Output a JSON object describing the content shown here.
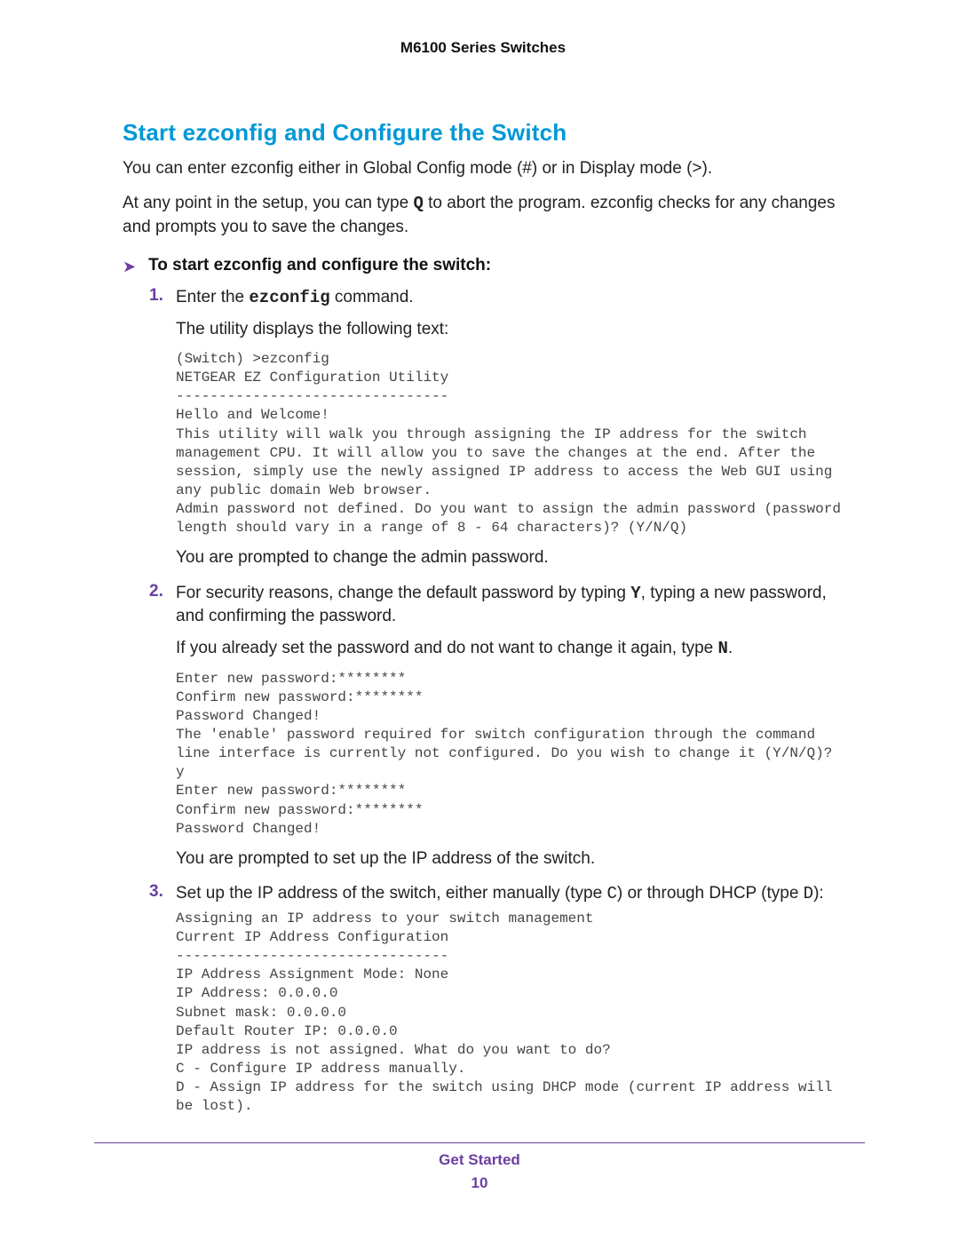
{
  "header": {
    "title": "M6100 Series Switches"
  },
  "section": {
    "title": "Start ezconfig and Configure the Switch",
    "intro1_a": "You can enter ezconfig either in Global Config mode (#) or in Display mode (>).",
    "intro2_a": "At any point in the setup, you can type ",
    "intro2_code": "Q",
    "intro2_b": " to abort the program. ezconfig checks for any changes and prompts you to save the changes."
  },
  "procedure": {
    "arrow": "➤",
    "title": "To start ezconfig and configure the switch:",
    "steps": [
      {
        "num": "1.",
        "text_a": "Enter the ",
        "code": "ezconfig",
        "text_b": " command.",
        "sub1": "The utility displays the following text:",
        "console": "(Switch) >ezconfig\nNETGEAR EZ Configuration Utility\n--------------------------------\nHello and Welcome!\nThis utility will walk you through assigning the IP address for the switch management CPU. It will allow you to save the changes at the end. After the session, simply use the newly assigned IP address to access the Web GUI using any public domain Web browser.\nAdmin password not defined. Do you want to assign the admin password (password length should vary in a range of 8 - 64 characters)? (Y/N/Q)",
        "sub2": "You are prompted to change the admin password."
      },
      {
        "num": "2.",
        "text_a": "For security reasons, change the default password by typing ",
        "code1": "Y",
        "text_b": ", typing a new password, and confirming the password.",
        "sub1_a": "If you already set the password and do not want to change it again, type ",
        "sub1_code": "N",
        "sub1_b": ".",
        "console": "Enter new password:********\nConfirm new password:********\nPassword Changed!\nThe 'enable' password required for switch configuration through the command line interface is currently not configured. Do you wish to change it (Y/N/Q)?  y\nEnter new password:********\nConfirm new password:********\nPassword Changed!",
        "sub2": "You are prompted to set up the IP address of the switch."
      },
      {
        "num": "3.",
        "text_a": "Set up the IP address of the switch, either manually (type ",
        "code1": "C",
        "text_b": ") or through DHCP (type ",
        "code2": "D",
        "text_c": "):",
        "console": "Assigning an IP address to your switch management\nCurrent IP Address Configuration\n--------------------------------\nIP Address Assignment Mode: None\nIP Address: 0.0.0.0\nSubnet mask: 0.0.0.0\nDefault Router IP: 0.0.0.0\nIP address is not assigned. What do you want to do?\nC - Configure IP address manually.\nD - Assign IP address for the switch using DHCP mode (current IP address will be lost)."
      }
    ]
  },
  "footer": {
    "label": "Get Started",
    "page": "10"
  }
}
